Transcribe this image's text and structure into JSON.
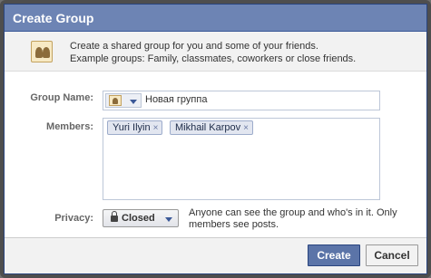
{
  "dialog": {
    "title": "Create Group"
  },
  "intro": {
    "icon": "group-icon",
    "line1": "Create a shared group for you and some of your friends.",
    "line2": "Example groups: Family, classmates, coworkers or close friends."
  },
  "form": {
    "group_name_label": "Group Name:",
    "group_name_value": "Новая группа",
    "members_label": "Members:",
    "members": [
      {
        "name": "Yuri Ilyin",
        "remove": "×"
      },
      {
        "name": "Mikhail Karpov",
        "remove": "×"
      }
    ],
    "privacy_label": "Privacy:",
    "privacy_value": "Closed",
    "privacy_description": "Anyone can see the group and who's in it. Only members see posts."
  },
  "buttons": {
    "create": "Create",
    "cancel": "Cancel"
  },
  "colors": {
    "title_bar": "#6d84b4",
    "primary_button": "#5b74a8",
    "token_bg": "#e2e6f0"
  }
}
